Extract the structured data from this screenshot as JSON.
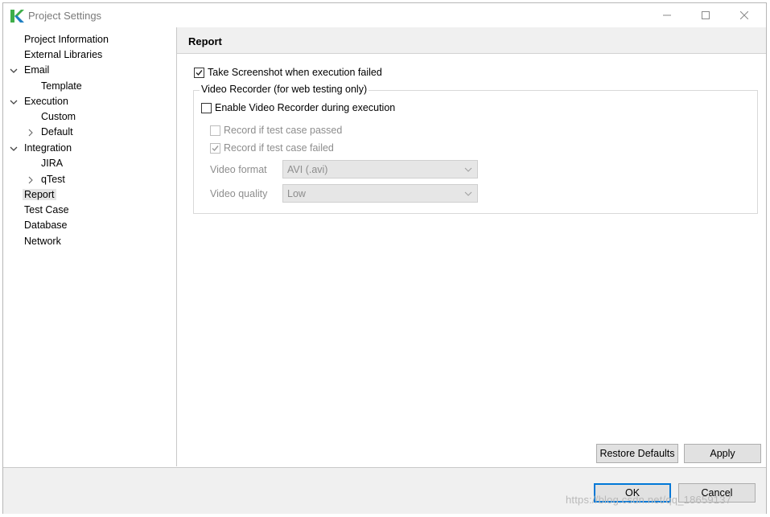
{
  "window": {
    "title": "Project Settings",
    "controls": {
      "minimize": "minimize",
      "maximize": "maximize",
      "close": "close"
    }
  },
  "tree": {
    "items": [
      {
        "label": "Project Information"
      },
      {
        "label": "External Libraries"
      },
      {
        "label": "Email",
        "expander": "chevron-down"
      },
      {
        "label": "Template"
      },
      {
        "label": "Execution",
        "expander": "chevron-down"
      },
      {
        "label": "Custom"
      },
      {
        "label": "Default",
        "expander": "chevron-right"
      },
      {
        "label": "Integration",
        "expander": "chevron-down"
      },
      {
        "label": "JIRA"
      },
      {
        "label": "qTest",
        "expander": "chevron-right"
      },
      {
        "label": "Report",
        "selected": true
      },
      {
        "label": "Test Case"
      },
      {
        "label": "Database"
      },
      {
        "label": "Network"
      }
    ]
  },
  "panel": {
    "title": "Report",
    "take_screenshot": {
      "label": "Take Screenshot when execution failed",
      "checked": true
    },
    "video_recorder": {
      "legend": "Video Recorder (for web testing only)",
      "enable": {
        "label": "Enable Video Recorder during execution",
        "checked": false
      },
      "record_passed": {
        "label": "Record if test case passed",
        "checked": false,
        "disabled": true
      },
      "record_failed": {
        "label": "Record if test case failed",
        "checked": true,
        "disabled": true
      },
      "video_format": {
        "label": "Video format",
        "value": "AVI (.avi)"
      },
      "video_quality": {
        "label": "Video quality",
        "value": "Low"
      }
    },
    "restore_defaults": "Restore Defaults",
    "apply": "Apply"
  },
  "footer": {
    "ok": "OK",
    "cancel": "Cancel"
  },
  "watermark": "https://blog.csdn.net/qq_18659137",
  "colors": {
    "accent": "#0078d7",
    "logo_green": "#3fae49",
    "logo_blue": "#1f7fc1"
  }
}
